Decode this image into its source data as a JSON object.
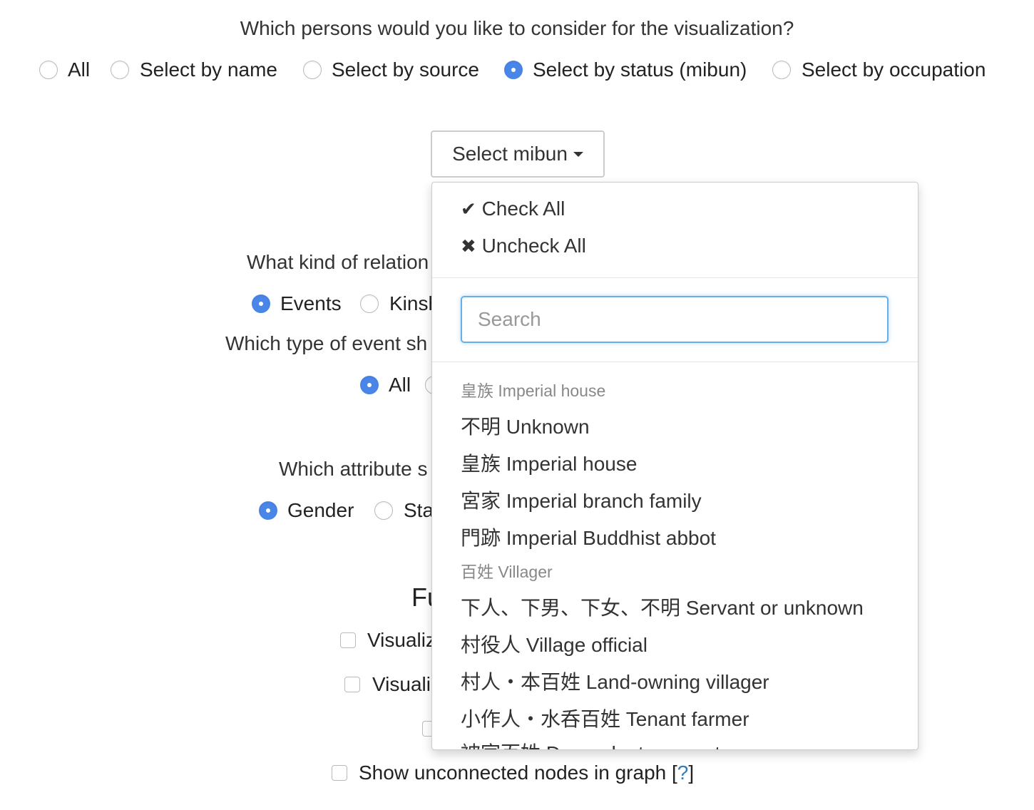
{
  "question": "Which persons would you like to consider for the visualization?",
  "person_filter": {
    "options": [
      "All",
      "Select by name",
      "Select by source",
      "Select by status (mibun)",
      "Select by occupation"
    ],
    "selected": "Select by status (mibun)"
  },
  "mibun_button": {
    "label": "Select mibun",
    "icon": "caret-down-icon"
  },
  "dropdown": {
    "check_all": "Check All",
    "uncheck_all": "Uncheck All",
    "search_placeholder": "Search",
    "groups": [
      {
        "header": "皇族 Imperial house",
        "items": [
          "不明 Unknown",
          "皇族 Imperial house",
          "宮家 Imperial branch family",
          "門跡 Imperial Buddhist abbot"
        ]
      },
      {
        "header": "百姓 Villager",
        "items": [
          "下人、下男、下女、不明 Servant or unknown",
          "村役人 Village official",
          "村人・本百姓 Land-owning villager",
          "小作人・水呑百姓 Tenant farmer",
          "被官百姓 Dependent peasant"
        ]
      }
    ]
  },
  "background": {
    "relation_question": "What kind of relation",
    "relation_options": [
      "Events",
      "Kinsh"
    ],
    "event_question": "Which type of event sh",
    "event_options": [
      "All"
    ],
    "attribute_question": "Which attribute s",
    "attribute_options": [
      "Gender",
      "Sta"
    ],
    "section_heading": "Fu",
    "checkbox_1": "Visualiz",
    "checkbox_2": "Visuali",
    "unconnected_label": "Show unconnected nodes in graph [",
    "help_link": "?",
    "help_close": "]"
  },
  "colors": {
    "accent": "#4a86e8",
    "focus": "#66afe9",
    "link": "#337ab7"
  }
}
